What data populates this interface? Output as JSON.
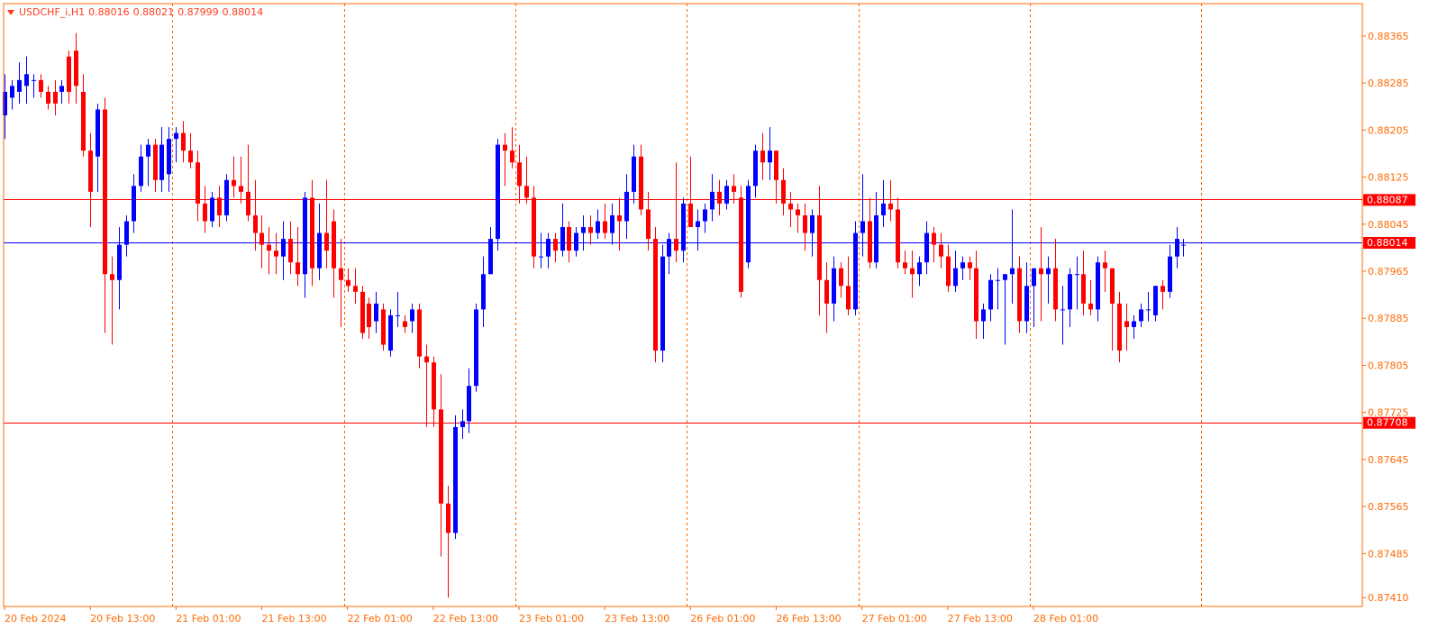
{
  "header": {
    "symbol": "USDCHF_i,H1",
    "open": "0.88016",
    "high": "0.88021",
    "low": "0.87999",
    "close": "0.88014"
  },
  "colors": {
    "axis": "#ff6a00",
    "frame": "#ff6a00",
    "grid": "#ff6a00",
    "bull": "#0000ff",
    "bear": "#ff0000",
    "hline": "#ff0000",
    "bid_line": "#0000ff",
    "label_text": "#ffffff"
  },
  "chart_data": {
    "type": "candlestick",
    "title": "USDCHF_i,H1",
    "ylim": [
      0.87395,
      0.8842
    ],
    "y_ticks": [
      "0.88365",
      "0.88285",
      "0.88205",
      "0.88125",
      "0.88045",
      "0.87965",
      "0.87885",
      "0.87805",
      "0.87725",
      "0.87645",
      "0.87565",
      "0.87485",
      "0.87410"
    ],
    "x_ticks": [
      {
        "index": 0,
        "label": "20 Feb 2024"
      },
      {
        "index": 12,
        "label": "20 Feb 13:00"
      },
      {
        "index": 24,
        "label": "21 Feb 01:00"
      },
      {
        "index": 36,
        "label": "21 Feb 13:00"
      },
      {
        "index": 48,
        "label": "22 Feb 01:00"
      },
      {
        "index": 60,
        "label": "22 Feb 13:00"
      },
      {
        "index": 72,
        "label": "23 Feb 01:00"
      },
      {
        "index": 84,
        "label": "23 Feb 13:00"
      },
      {
        "index": 96,
        "label": "26 Feb 01:00"
      },
      {
        "index": 108,
        "label": "26 Feb 13:00"
      },
      {
        "index": 120,
        "label": "27 Feb 01:00"
      },
      {
        "index": 132,
        "label": "27 Feb 13:00"
      },
      {
        "index": 144,
        "label": "28 Feb 01:00"
      }
    ],
    "separator_indices": [
      23.5,
      47.5,
      71.5,
      95.5,
      119.5,
      143.5,
      167.5
    ],
    "h_lines": [
      {
        "value": 0.88087,
        "label": "0.88087",
        "kind": "level"
      },
      {
        "value": 0.87708,
        "label": "0.87708",
        "kind": "level"
      }
    ],
    "bid": {
      "value": 0.88014,
      "label": "0.88014"
    },
    "candles": [
      {
        "o": 0.8823,
        "h": 0.883,
        "l": 0.8819,
        "c": 0.8827
      },
      {
        "o": 0.8826,
        "h": 0.8829,
        "l": 0.8824,
        "c": 0.8828
      },
      {
        "o": 0.8827,
        "h": 0.8832,
        "l": 0.8825,
        "c": 0.8829
      },
      {
        "o": 0.8828,
        "h": 0.8833,
        "l": 0.8825,
        "c": 0.883
      },
      {
        "o": 0.8829,
        "h": 0.883,
        "l": 0.8826,
        "c": 0.8829
      },
      {
        "o": 0.8829,
        "h": 0.883,
        "l": 0.8826,
        "c": 0.8827
      },
      {
        "o": 0.8827,
        "h": 0.8828,
        "l": 0.8824,
        "c": 0.8825
      },
      {
        "o": 0.8827,
        "h": 0.8829,
        "l": 0.8823,
        "c": 0.8825
      },
      {
        "o": 0.8827,
        "h": 0.8829,
        "l": 0.8825,
        "c": 0.8828
      },
      {
        "o": 0.8833,
        "h": 0.8834,
        "l": 0.8825,
        "c": 0.8827
      },
      {
        "o": 0.8834,
        "h": 0.8837,
        "l": 0.8825,
        "c": 0.8828
      },
      {
        "o": 0.8827,
        "h": 0.883,
        "l": 0.8816,
        "c": 0.8817
      },
      {
        "o": 0.8817,
        "h": 0.882,
        "l": 0.8804,
        "c": 0.881
      },
      {
        "o": 0.8816,
        "h": 0.8825,
        "l": 0.881,
        "c": 0.8824
      },
      {
        "o": 0.8824,
        "h": 0.8826,
        "l": 0.8786,
        "c": 0.8796
      },
      {
        "o": 0.8796,
        "h": 0.8799,
        "l": 0.8784,
        "c": 0.8795
      },
      {
        "o": 0.8795,
        "h": 0.8804,
        "l": 0.879,
        "c": 0.8801
      },
      {
        "o": 0.8801,
        "h": 0.8806,
        "l": 0.8799,
        "c": 0.8805
      },
      {
        "o": 0.8805,
        "h": 0.8813,
        "l": 0.8803,
        "c": 0.8811
      },
      {
        "o": 0.8811,
        "h": 0.8818,
        "l": 0.881,
        "c": 0.8816
      },
      {
        "o": 0.8816,
        "h": 0.8819,
        "l": 0.8811,
        "c": 0.8818
      },
      {
        "o": 0.8818,
        "h": 0.8819,
        "l": 0.881,
        "c": 0.8812
      },
      {
        "o": 0.8812,
        "h": 0.8821,
        "l": 0.881,
        "c": 0.8818
      },
      {
        "o": 0.8813,
        "h": 0.8821,
        "l": 0.881,
        "c": 0.8819
      },
      {
        "o": 0.8819,
        "h": 0.8821,
        "l": 0.8815,
        "c": 0.882
      },
      {
        "o": 0.882,
        "h": 0.8822,
        "l": 0.8815,
        "c": 0.8817
      },
      {
        "o": 0.8817,
        "h": 0.882,
        "l": 0.8814,
        "c": 0.8815
      },
      {
        "o": 0.8815,
        "h": 0.8817,
        "l": 0.8805,
        "c": 0.8808
      },
      {
        "o": 0.8808,
        "h": 0.8811,
        "l": 0.8803,
        "c": 0.8805
      },
      {
        "o": 0.8805,
        "h": 0.881,
        "l": 0.8804,
        "c": 0.8809
      },
      {
        "o": 0.8809,
        "h": 0.8811,
        "l": 0.8804,
        "c": 0.8806
      },
      {
        "o": 0.8806,
        "h": 0.8813,
        "l": 0.8805,
        "c": 0.8812
      },
      {
        "o": 0.8812,
        "h": 0.8816,
        "l": 0.8809,
        "c": 0.8811
      },
      {
        "o": 0.8811,
        "h": 0.8816,
        "l": 0.8808,
        "c": 0.881
      },
      {
        "o": 0.881,
        "h": 0.8818,
        "l": 0.8805,
        "c": 0.8806
      },
      {
        "o": 0.8806,
        "h": 0.8812,
        "l": 0.88,
        "c": 0.8803
      },
      {
        "o": 0.8803,
        "h": 0.8806,
        "l": 0.8797,
        "c": 0.8801
      },
      {
        "o": 0.8801,
        "h": 0.8804,
        "l": 0.8796,
        "c": 0.88
      },
      {
        "o": 0.88,
        "h": 0.8803,
        "l": 0.8796,
        "c": 0.8799
      },
      {
        "o": 0.8799,
        "h": 0.8805,
        "l": 0.8795,
        "c": 0.8802
      },
      {
        "o": 0.8802,
        "h": 0.8805,
        "l": 0.8796,
        "c": 0.8798
      },
      {
        "o": 0.8798,
        "h": 0.8804,
        "l": 0.8794,
        "c": 0.8796
      },
      {
        "o": 0.8796,
        "h": 0.881,
        "l": 0.8792,
        "c": 0.8809
      },
      {
        "o": 0.8809,
        "h": 0.8812,
        "l": 0.8794,
        "c": 0.8797
      },
      {
        "o": 0.8797,
        "h": 0.8808,
        "l": 0.8795,
        "c": 0.8803
      },
      {
        "o": 0.8803,
        "h": 0.8812,
        "l": 0.8797,
        "c": 0.88
      },
      {
        "o": 0.8805,
        "h": 0.8807,
        "l": 0.8792,
        "c": 0.8797
      },
      {
        "o": 0.8797,
        "h": 0.8802,
        "l": 0.8787,
        "c": 0.8795
      },
      {
        "o": 0.8795,
        "h": 0.8797,
        "l": 0.8793,
        "c": 0.8794
      },
      {
        "o": 0.8794,
        "h": 0.8797,
        "l": 0.8791,
        "c": 0.8793
      },
      {
        "o": 0.8793,
        "h": 0.8794,
        "l": 0.8785,
        "c": 0.8786
      },
      {
        "o": 0.8791,
        "h": 0.8792,
        "l": 0.8785,
        "c": 0.8787
      },
      {
        "o": 0.8788,
        "h": 0.8793,
        "l": 0.8786,
        "c": 0.8791
      },
      {
        "o": 0.879,
        "h": 0.8791,
        "l": 0.8783,
        "c": 0.8784
      },
      {
        "o": 0.8783,
        "h": 0.879,
        "l": 0.8782,
        "c": 0.8789
      },
      {
        "o": 0.8789,
        "h": 0.8793,
        "l": 0.8787,
        "c": 0.8789
      },
      {
        "o": 0.8788,
        "h": 0.8789,
        "l": 0.8786,
        "c": 0.8787
      },
      {
        "o": 0.8788,
        "h": 0.8791,
        "l": 0.8786,
        "c": 0.879
      },
      {
        "o": 0.879,
        "h": 0.8791,
        "l": 0.878,
        "c": 0.8782
      },
      {
        "o": 0.8782,
        "h": 0.8784,
        "l": 0.877,
        "c": 0.8781
      },
      {
        "o": 0.8781,
        "h": 0.8782,
        "l": 0.877,
        "c": 0.8773
      },
      {
        "o": 0.8773,
        "h": 0.8779,
        "l": 0.8748,
        "c": 0.8757
      },
      {
        "o": 0.8757,
        "h": 0.876,
        "l": 0.8741,
        "c": 0.8752
      },
      {
        "o": 0.8752,
        "h": 0.8772,
        "l": 0.8751,
        "c": 0.877
      },
      {
        "o": 0.877,
        "h": 0.8773,
        "l": 0.8768,
        "c": 0.8771
      },
      {
        "o": 0.8771,
        "h": 0.878,
        "l": 0.8769,
        "c": 0.8777
      },
      {
        "o": 0.8777,
        "h": 0.8791,
        "l": 0.8776,
        "c": 0.879
      },
      {
        "o": 0.879,
        "h": 0.8799,
        "l": 0.8787,
        "c": 0.8796
      },
      {
        "o": 0.8796,
        "h": 0.8804,
        "l": 0.8796,
        "c": 0.8802
      },
      {
        "o": 0.8802,
        "h": 0.8819,
        "l": 0.88,
        "c": 0.8818
      },
      {
        "o": 0.8818,
        "h": 0.882,
        "l": 0.8811,
        "c": 0.8817
      },
      {
        "o": 0.8817,
        "h": 0.8821,
        "l": 0.8814,
        "c": 0.8815
      },
      {
        "o": 0.8815,
        "h": 0.8818,
        "l": 0.8808,
        "c": 0.8811
      },
      {
        "o": 0.8811,
        "h": 0.8816,
        "l": 0.8808,
        "c": 0.8809
      },
      {
        "o": 0.8809,
        "h": 0.8811,
        "l": 0.8797,
        "c": 0.8799
      },
      {
        "o": 0.8799,
        "h": 0.8803,
        "l": 0.8797,
        "c": 0.8799
      },
      {
        "o": 0.8799,
        "h": 0.8803,
        "l": 0.8797,
        "c": 0.8802
      },
      {
        "o": 0.8802,
        "h": 0.8803,
        "l": 0.8798,
        "c": 0.88
      },
      {
        "o": 0.88,
        "h": 0.8808,
        "l": 0.8799,
        "c": 0.8804
      },
      {
        "o": 0.8804,
        "h": 0.8805,
        "l": 0.8798,
        "c": 0.88
      },
      {
        "o": 0.88,
        "h": 0.8804,
        "l": 0.8799,
        "c": 0.8803
      },
      {
        "o": 0.8803,
        "h": 0.8806,
        "l": 0.88,
        "c": 0.8804
      },
      {
        "o": 0.8804,
        "h": 0.8806,
        "l": 0.8801,
        "c": 0.8803
      },
      {
        "o": 0.8803,
        "h": 0.8807,
        "l": 0.8802,
        "c": 0.8805
      },
      {
        "o": 0.8805,
        "h": 0.8808,
        "l": 0.8802,
        "c": 0.8803
      },
      {
        "o": 0.8803,
        "h": 0.8808,
        "l": 0.8801,
        "c": 0.8806
      },
      {
        "o": 0.8806,
        "h": 0.8809,
        "l": 0.88,
        "c": 0.8805
      },
      {
        "o": 0.8805,
        "h": 0.8813,
        "l": 0.8802,
        "c": 0.881
      },
      {
        "o": 0.881,
        "h": 0.8818,
        "l": 0.8808,
        "c": 0.8816
      },
      {
        "o": 0.8816,
        "h": 0.8818,
        "l": 0.8806,
        "c": 0.8807
      },
      {
        "o": 0.8807,
        "h": 0.881,
        "l": 0.88,
        "c": 0.8802
      },
      {
        "o": 0.8802,
        "h": 0.8804,
        "l": 0.8781,
        "c": 0.8783
      },
      {
        "o": 0.8783,
        "h": 0.8801,
        "l": 0.8781,
        "c": 0.8799
      },
      {
        "o": 0.8799,
        "h": 0.8803,
        "l": 0.8796,
        "c": 0.8802
      },
      {
        "o": 0.8802,
        "h": 0.8815,
        "l": 0.8798,
        "c": 0.88
      },
      {
        "o": 0.88,
        "h": 0.8809,
        "l": 0.8798,
        "c": 0.8808
      },
      {
        "o": 0.8808,
        "h": 0.8816,
        "l": 0.8804,
        "c": 0.8804
      },
      {
        "o": 0.8804,
        "h": 0.8807,
        "l": 0.88,
        "c": 0.8805
      },
      {
        "o": 0.8805,
        "h": 0.8808,
        "l": 0.8803,
        "c": 0.8807
      },
      {
        "o": 0.8807,
        "h": 0.8813,
        "l": 0.8805,
        "c": 0.881
      },
      {
        "o": 0.881,
        "h": 0.8812,
        "l": 0.8806,
        "c": 0.8808
      },
      {
        "o": 0.8808,
        "h": 0.8812,
        "l": 0.8807,
        "c": 0.8811
      },
      {
        "o": 0.8811,
        "h": 0.8813,
        "l": 0.8808,
        "c": 0.881
      },
      {
        "o": 0.8809,
        "h": 0.8811,
        "l": 0.8792,
        "c": 0.8793
      },
      {
        "o": 0.8798,
        "h": 0.8812,
        "l": 0.8797,
        "c": 0.8811
      },
      {
        "o": 0.8811,
        "h": 0.8818,
        "l": 0.8809,
        "c": 0.8817
      },
      {
        "o": 0.8817,
        "h": 0.882,
        "l": 0.8812,
        "c": 0.8815
      },
      {
        "o": 0.8815,
        "h": 0.8821,
        "l": 0.8812,
        "c": 0.8817
      },
      {
        "o": 0.8817,
        "h": 0.8817,
        "l": 0.8808,
        "c": 0.8812
      },
      {
        "o": 0.8812,
        "h": 0.8814,
        "l": 0.8806,
        "c": 0.8808
      },
      {
        "o": 0.8808,
        "h": 0.881,
        "l": 0.8804,
        "c": 0.8807
      },
      {
        "o": 0.8807,
        "h": 0.8808,
        "l": 0.8803,
        "c": 0.8806
      },
      {
        "o": 0.8806,
        "h": 0.8808,
        "l": 0.88,
        "c": 0.8803
      },
      {
        "o": 0.8803,
        "h": 0.8807,
        "l": 0.8799,
        "c": 0.8806
      },
      {
        "o": 0.8806,
        "h": 0.8811,
        "l": 0.8789,
        "c": 0.8795
      },
      {
        "o": 0.8795,
        "h": 0.8798,
        "l": 0.8786,
        "c": 0.8791
      },
      {
        "o": 0.8791,
        "h": 0.8799,
        "l": 0.8788,
        "c": 0.8797
      },
      {
        "o": 0.8797,
        "h": 0.8798,
        "l": 0.8792,
        "c": 0.8794
      },
      {
        "o": 0.8794,
        "h": 0.8799,
        "l": 0.8789,
        "c": 0.879
      },
      {
        "o": 0.879,
        "h": 0.8805,
        "l": 0.8789,
        "c": 0.8803
      },
      {
        "o": 0.8803,
        "h": 0.8813,
        "l": 0.8799,
        "c": 0.8805
      },
      {
        "o": 0.8805,
        "h": 0.8809,
        "l": 0.8797,
        "c": 0.8798
      },
      {
        "o": 0.8798,
        "h": 0.881,
        "l": 0.8797,
        "c": 0.8806
      },
      {
        "o": 0.8806,
        "h": 0.8812,
        "l": 0.8804,
        "c": 0.8808
      },
      {
        "o": 0.8808,
        "h": 0.8812,
        "l": 0.8805,
        "c": 0.8807
      },
      {
        "o": 0.8807,
        "h": 0.8809,
        "l": 0.8797,
        "c": 0.8798
      },
      {
        "o": 0.8798,
        "h": 0.88,
        "l": 0.8796,
        "c": 0.8797
      },
      {
        "o": 0.8797,
        "h": 0.88,
        "l": 0.8792,
        "c": 0.8796
      },
      {
        "o": 0.8796,
        "h": 0.8799,
        "l": 0.8794,
        "c": 0.8798
      },
      {
        "o": 0.8798,
        "h": 0.8805,
        "l": 0.8796,
        "c": 0.8803
      },
      {
        "o": 0.8803,
        "h": 0.8804,
        "l": 0.8798,
        "c": 0.8801
      },
      {
        "o": 0.8801,
        "h": 0.8803,
        "l": 0.8797,
        "c": 0.8799
      },
      {
        "o": 0.8799,
        "h": 0.8801,
        "l": 0.8793,
        "c": 0.8794
      },
      {
        "o": 0.8794,
        "h": 0.88,
        "l": 0.8793,
        "c": 0.8797
      },
      {
        "o": 0.8797,
        "h": 0.8799,
        "l": 0.8795,
        "c": 0.8798
      },
      {
        "o": 0.8798,
        "h": 0.8799,
        "l": 0.8795,
        "c": 0.8797
      },
      {
        "o": 0.8797,
        "h": 0.88,
        "l": 0.8785,
        "c": 0.8788
      },
      {
        "o": 0.8788,
        "h": 0.8791,
        "l": 0.8785,
        "c": 0.879
      },
      {
        "o": 0.879,
        "h": 0.8796,
        "l": 0.8788,
        "c": 0.8795
      },
      {
        "o": 0.8795,
        "h": 0.8797,
        "l": 0.879,
        "c": 0.8795
      },
      {
        "o": 0.8795,
        "h": 0.8796,
        "l": 0.8784,
        "c": 0.8796
      },
      {
        "o": 0.8796,
        "h": 0.8807,
        "l": 0.8791,
        "c": 0.8797
      },
      {
        "o": 0.8797,
        "h": 0.8799,
        "l": 0.8786,
        "c": 0.8788
      },
      {
        "o": 0.8788,
        "h": 0.8798,
        "l": 0.8786,
        "c": 0.8794
      },
      {
        "o": 0.8794,
        "h": 0.8797,
        "l": 0.8787,
        "c": 0.8797
      },
      {
        "o": 0.8797,
        "h": 0.8804,
        "l": 0.8788,
        "c": 0.8796
      },
      {
        "o": 0.8796,
        "h": 0.8799,
        "l": 0.8791,
        "c": 0.8797
      },
      {
        "o": 0.8797,
        "h": 0.8802,
        "l": 0.8788,
        "c": 0.879
      },
      {
        "o": 0.879,
        "h": 0.8794,
        "l": 0.8784,
        "c": 0.879
      },
      {
        "o": 0.879,
        "h": 0.8797,
        "l": 0.8787,
        "c": 0.8796
      },
      {
        "o": 0.8796,
        "h": 0.8799,
        "l": 0.879,
        "c": 0.8796
      },
      {
        "o": 0.8796,
        "h": 0.88,
        "l": 0.8789,
        "c": 0.8791
      },
      {
        "o": 0.8791,
        "h": 0.8795,
        "l": 0.8789,
        "c": 0.879
      },
      {
        "o": 0.879,
        "h": 0.8799,
        "l": 0.8788,
        "c": 0.8798
      },
      {
        "o": 0.8798,
        "h": 0.88,
        "l": 0.8793,
        "c": 0.8797
      },
      {
        "o": 0.8797,
        "h": 0.8797,
        "l": 0.8783,
        "c": 0.8791
      },
      {
        "o": 0.8791,
        "h": 0.8793,
        "l": 0.8781,
        "c": 0.8783
      },
      {
        "o": 0.8788,
        "h": 0.8791,
        "l": 0.8783,
        "c": 0.8787
      },
      {
        "o": 0.8787,
        "h": 0.8789,
        "l": 0.8785,
        "c": 0.8788
      },
      {
        "o": 0.8788,
        "h": 0.8791,
        "l": 0.8787,
        "c": 0.879
      },
      {
        "o": 0.879,
        "h": 0.8793,
        "l": 0.8788,
        "c": 0.879
      },
      {
        "o": 0.8789,
        "h": 0.8794,
        "l": 0.8788,
        "c": 0.8794
      },
      {
        "o": 0.8794,
        "h": 0.8795,
        "l": 0.879,
        "c": 0.8793
      },
      {
        "o": 0.8793,
        "h": 0.8801,
        "l": 0.8792,
        "c": 0.8799
      },
      {
        "o": 0.8799,
        "h": 0.8804,
        "l": 0.8797,
        "c": 0.8802
      },
      {
        "o": 0.8801,
        "h": 0.8802,
        "l": 0.8799,
        "c": 0.8801
      }
    ]
  }
}
